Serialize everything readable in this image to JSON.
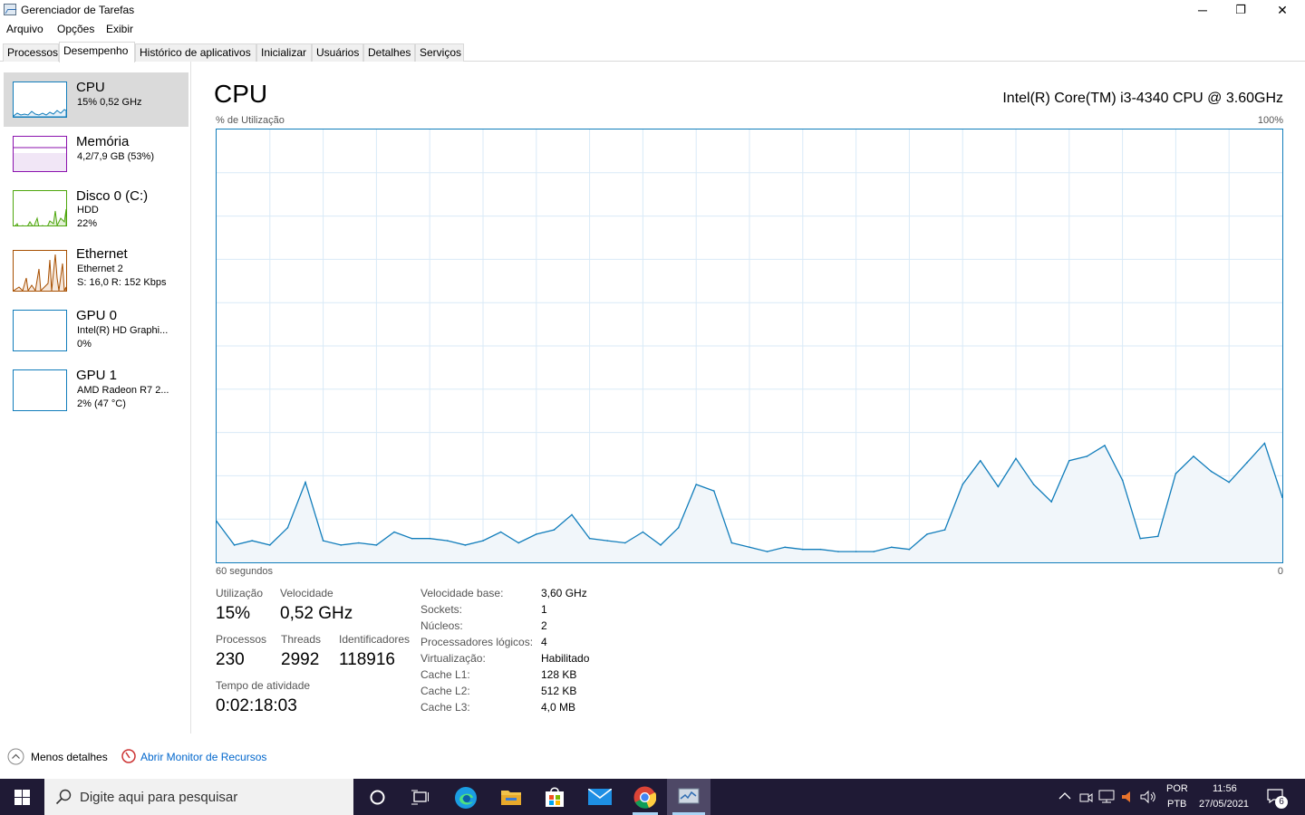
{
  "window": {
    "title": "Gerenciador de Tarefas",
    "minimize": "─",
    "restore": "❐",
    "close": "✕"
  },
  "menu": [
    "Arquivo",
    "Opções",
    "Exibir"
  ],
  "tabs": [
    "Processos",
    "Desempenho",
    "Histórico de aplicativos",
    "Inicializar",
    "Usuários",
    "Detalhes",
    "Serviços"
  ],
  "active_tab": "Desempenho",
  "resources": [
    {
      "name": "CPU",
      "line1": "15%  0,52 GHz",
      "line2": "",
      "color": "#117dbb"
    },
    {
      "name": "Memória",
      "line1": "4,2/7,9 GB (53%)",
      "line2": "",
      "color": "#8b12ae"
    },
    {
      "name": "Disco 0 (C:)",
      "line1": "HDD",
      "line2": "22%",
      "color": "#4da60c"
    },
    {
      "name": "Ethernet",
      "line1": "Ethernet 2",
      "line2": "S: 16,0  R: 152 Kbps",
      "color": "#a74f01"
    },
    {
      "name": "GPU 0",
      "line1": "Intel(R) HD Graphi...",
      "line2": "0%",
      "color": "#117dbb"
    },
    {
      "name": "GPU 1",
      "line1": "AMD Radeon R7 2...",
      "line2": "2% (47 °C)",
      "color": "#117dbb"
    }
  ],
  "main": {
    "title": "CPU",
    "model": "Intel(R) Core(TM) i3-4340 CPU @ 3.60GHz",
    "y_label": "% de Utilização",
    "y_max": "100%",
    "x_left": "60 segundos",
    "x_right": "0"
  },
  "chart_data": {
    "type": "area",
    "title": "",
    "xlabel": "60 segundos",
    "ylabel": "% de Utilização",
    "ylim": [
      0,
      100
    ],
    "x": [
      60,
      59,
      58,
      57,
      56,
      55,
      54,
      53,
      52,
      51,
      50,
      49,
      48,
      47,
      46,
      45,
      44,
      43,
      42,
      41,
      40,
      39,
      38,
      37,
      36,
      35,
      34,
      33,
      32,
      31,
      30,
      29,
      28,
      27,
      26,
      25,
      24,
      23,
      22,
      21,
      20,
      19,
      18,
      17,
      16,
      15,
      14,
      13,
      12,
      11,
      10,
      9,
      8,
      7,
      6,
      5,
      4,
      3,
      2,
      1,
      0
    ],
    "values": [
      9.5,
      4,
      5,
      4,
      8,
      18.5,
      5,
      4,
      4.5,
      4,
      7,
      5.5,
      5.5,
      5,
      4,
      5,
      7,
      4.5,
      6.5,
      7.5,
      11,
      5.5,
      5,
      4.5,
      7,
      4,
      8,
      18,
      16.5,
      4.5,
      3.5,
      2.5,
      3.5,
      3,
      3,
      2.5,
      2.5,
      2.5,
      3.5,
      3,
      6.5,
      7.5,
      18,
      23.5,
      17.5,
      24,
      18,
      14,
      23.5,
      24.5,
      27,
      19,
      5.5,
      6,
      20.5,
      24.5,
      21,
      18.5,
      23,
      27.5,
      15
    ],
    "grid": true,
    "color": "#117dbb"
  },
  "stats": {
    "util_label": "Utilização",
    "util_value": "15%",
    "speed_label": "Velocidade",
    "speed_value": "0,52 GHz",
    "proc_label": "Processos",
    "proc_value": "230",
    "threads_label": "Threads",
    "threads_value": "2992",
    "handles_label": "Identificadores",
    "handles_value": "118916",
    "uptime_label": "Tempo de atividade",
    "uptime_value": "0:02:18:03"
  },
  "specs": [
    {
      "label": "Velocidade base:",
      "value": "3,60 GHz"
    },
    {
      "label": "Sockets:",
      "value": "1"
    },
    {
      "label": "Núcleos:",
      "value": "2"
    },
    {
      "label": "Processadores lógicos:",
      "value": "4"
    },
    {
      "label": "Virtualização:",
      "value": "Habilitado"
    },
    {
      "label": "Cache L1:",
      "value": "128 KB"
    },
    {
      "label": "Cache L2:",
      "value": "512 KB"
    },
    {
      "label": "Cache L3:",
      "value": "4,0 MB"
    }
  ],
  "bottom": {
    "fewer_details": "Menos detalhes",
    "resource_monitor": "Abrir Monitor de Recursos"
  },
  "taskbar": {
    "search_placeholder": "Digite aqui para pesquisar",
    "lang1": "POR",
    "lang2": "PTB",
    "time": "11:56",
    "date": "27/05/2021",
    "notifications": "6"
  }
}
